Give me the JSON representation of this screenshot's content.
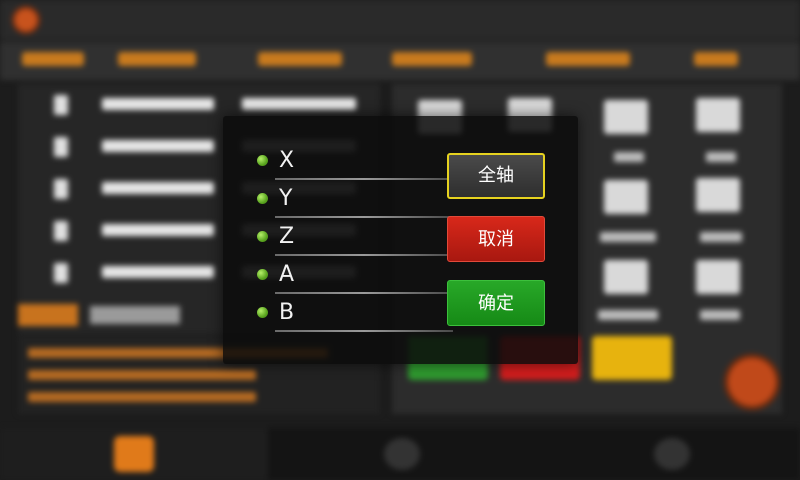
{
  "modal": {
    "axes": [
      {
        "label": "X"
      },
      {
        "label": "Y"
      },
      {
        "label": "Z"
      },
      {
        "label": "A"
      },
      {
        "label": "B"
      }
    ],
    "buttons": {
      "all_axes": "全轴",
      "cancel": "取消",
      "confirm": "确定"
    }
  },
  "colors": {
    "accent_orange": "#c87a1e",
    "indicator_green": "#5aa51f",
    "highlight_yellow": "#e6d21f",
    "cancel_red": "#c82016",
    "confirm_green": "#1e9a1e"
  }
}
